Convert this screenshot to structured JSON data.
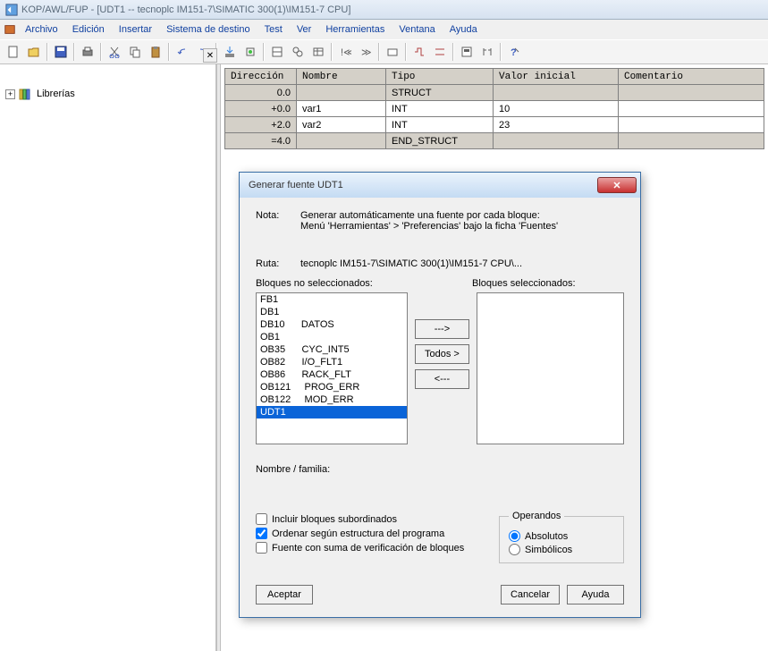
{
  "titlebar": "KOP/AWL/FUP  - [UDT1 -- tecnoplc IM151-7\\SIMATIC 300(1)\\IM151-7 CPU]",
  "menu": {
    "archivo": "Archivo",
    "edicion": "Edición",
    "insertar": "Insertar",
    "sistema": "Sistema de destino",
    "test": "Test",
    "ver": "Ver",
    "herramientas": "Herramientas",
    "ventana": "Ventana",
    "ayuda": "Ayuda"
  },
  "tree": {
    "librerias": "Librerías"
  },
  "table": {
    "hdr": {
      "direccion": "Dirección",
      "nombre": "Nombre",
      "tipo": "Tipo",
      "valor": "Valor inicial",
      "comentario": "Comentario"
    },
    "rows": [
      {
        "addr": "0.0",
        "name": "",
        "tipo": "STRUCT",
        "val": "",
        "ro": true
      },
      {
        "addr": "+0.0",
        "name": "var1",
        "tipo": "INT",
        "val": "10",
        "ro": false
      },
      {
        "addr": "+2.0",
        "name": "var2",
        "tipo": "INT",
        "val": "23",
        "ro": false
      },
      {
        "addr": "=4.0",
        "name": "",
        "tipo": "END_STRUCT",
        "val": "",
        "ro": true
      }
    ]
  },
  "dialog": {
    "title": "Generar fuente UDT1",
    "nota_label": "Nota:",
    "nota_text1": "Generar automáticamente una fuente por cada bloque:",
    "nota_text2": "Menú 'Herramientas'  >  'Preferencias' bajo la ficha 'Fuentes'",
    "ruta_label": "Ruta:",
    "ruta_value": "tecnoplc IM151-7\\SIMATIC 300(1)\\IM151-7 CPU\\...",
    "left_header": "Bloques no seleccionados:",
    "right_header": "Bloques seleccionados:",
    "blocks": [
      {
        "name": "FB1",
        "sym": ""
      },
      {
        "name": "DB1",
        "sym": ""
      },
      {
        "name": "DB10",
        "sym": "DATOS"
      },
      {
        "name": "OB1",
        "sym": ""
      },
      {
        "name": "OB35",
        "sym": "CYC_INT5"
      },
      {
        "name": "OB82",
        "sym": "I/O_FLT1"
      },
      {
        "name": "OB86",
        "sym": "RACK_FLT"
      },
      {
        "name": "OB121",
        "sym": "PROG_ERR"
      },
      {
        "name": "OB122",
        "sym": "MOD_ERR"
      },
      {
        "name": "UDT1",
        "sym": "",
        "sel": true
      }
    ],
    "btn_right": "--->",
    "btn_all": "Todos >",
    "btn_left": "<---",
    "nombre_fam": "Nombre / familia:",
    "chk1": "Incluir bloques subordinados",
    "chk2": "Ordenar según estructura del programa",
    "chk3": "Fuente con suma de verificación de bloques",
    "operandos": "Operandos",
    "op_abs": "Absolutos",
    "op_sim": "Simbólicos",
    "aceptar": "Aceptar",
    "cancelar": "Cancelar",
    "ayuda": "Ayuda"
  }
}
